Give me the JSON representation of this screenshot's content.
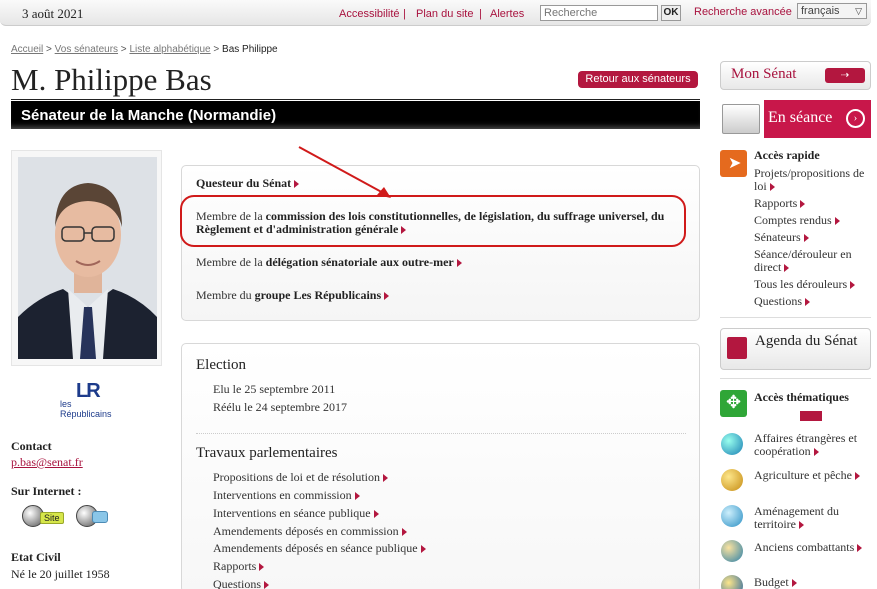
{
  "topbar": {
    "date": "3 août 2021",
    "links": [
      "Accessibilité",
      "Plan du site",
      "Alertes"
    ],
    "search_placeholder": "Recherche",
    "ok": "OK",
    "advanced": "Recherche avancée",
    "lang": "français"
  },
  "breadcrumb": {
    "items": [
      "Accueil",
      "Vos sénateurs",
      "Liste alphabétique"
    ],
    "current": "Bas Philippe"
  },
  "page_title": "M. Philippe Bas",
  "back_button": "Retour aux sénateurs",
  "banner": "Sénateur de la Manche (Normandie)",
  "roles": {
    "r1_bold": "Questeur du Sénat",
    "r2_pre": "Membre de la ",
    "r2_bold": "commission des lois constitutionnelles, de législation, du suffrage universel, du Règlement et d'administration générale",
    "r3_pre": "Membre de la ",
    "r3_bold": "délégation sénatoriale aux outre-mer",
    "r4_pre": "Membre du ",
    "r4_bold": "groupe Les Républicains"
  },
  "party_logo": {
    "mark": "LR",
    "line1": "les",
    "line2": "Républicains"
  },
  "contact": {
    "label": "Contact",
    "email": "p.bas@senat.fr",
    "internet_label": "Sur Internet :",
    "site_badge": "Site",
    "civil_label": "Etat Civil",
    "birth": "Né le 20 juillet 1958"
  },
  "election": {
    "heading": "Election",
    "lines": [
      "Elu le 25 septembre 2011",
      "Réélu le 24 septembre 2017"
    ]
  },
  "travaux": {
    "heading": "Travaux parlementaires",
    "items": [
      "Propositions de loi et de résolution",
      "Interventions en commission",
      "Interventions en séance publique",
      "Amendements déposés en commission",
      "Amendements déposés en séance publique",
      "Rapports",
      "Questions"
    ]
  },
  "sidebar": {
    "mon_senat": "Mon Sénat",
    "en_seance": "En séance",
    "acces_rapide": "Accès rapide",
    "rapide_items": [
      "Projets/propositions de loi",
      "Rapports",
      "Comptes rendus",
      "Sénateurs",
      "Séance/dérouleur en direct",
      "Tous les dérouleurs",
      "Questions"
    ],
    "agenda": "Agenda du Sénat",
    "acces_thematiques": "Accès thématiques",
    "themes": [
      "Affaires étrangères et coopération",
      "Agriculture et pêche",
      "Aménagement du territoire",
      "Anciens combattants",
      "Budget"
    ]
  },
  "colors": {
    "accent": "#a8123e",
    "annotation": "#d01a1a"
  }
}
